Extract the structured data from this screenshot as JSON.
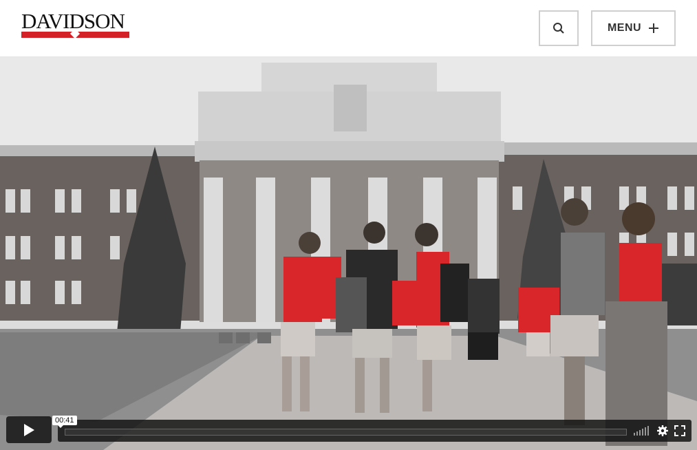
{
  "brand": {
    "name": "DAVIDSON",
    "accent": "#d42127"
  },
  "header": {
    "search_icon": "search-icon",
    "menu_label": "MENU",
    "menu_icon": "plus-icon"
  },
  "video": {
    "current_time": "00:41",
    "icons": [
      "play-icon",
      "volume-icon",
      "settings-icon",
      "fullscreen-icon"
    ]
  }
}
